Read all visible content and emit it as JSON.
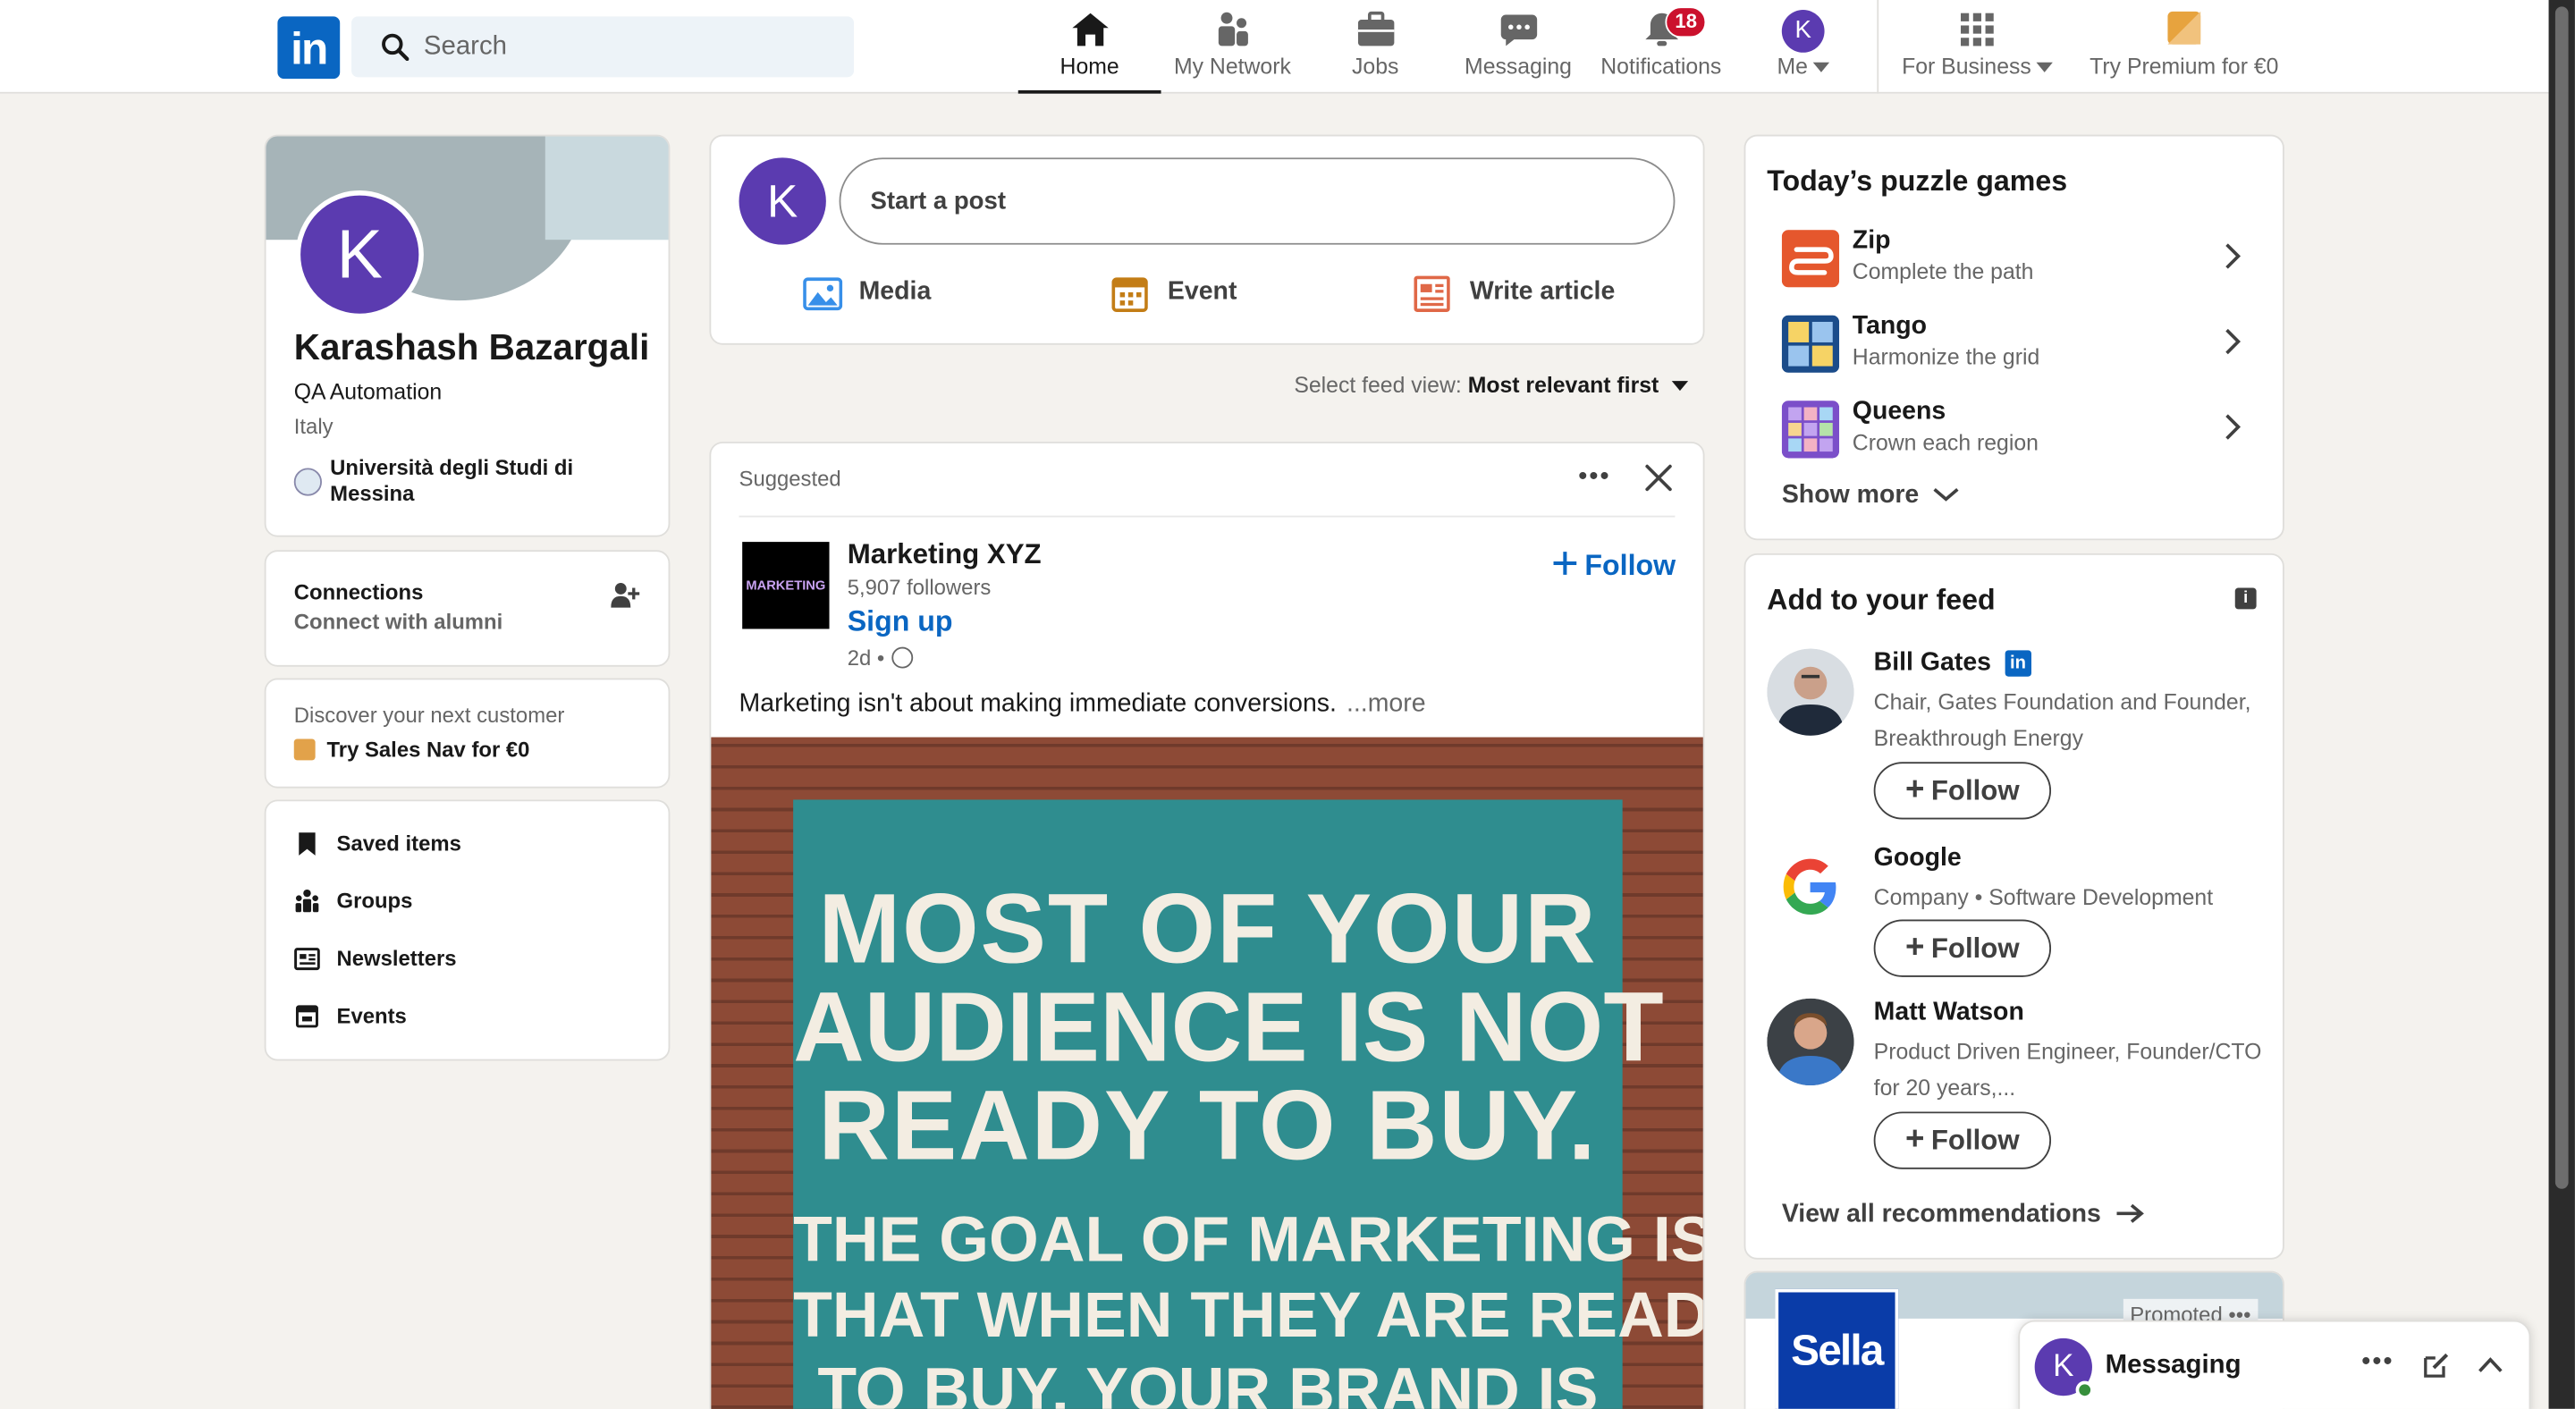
{
  "nav": {
    "logo_text": "in",
    "search_placeholder": "Search",
    "items": [
      {
        "label": "Home",
        "icon": "home-icon"
      },
      {
        "label": "My Network",
        "icon": "people-icon"
      },
      {
        "label": "Jobs",
        "icon": "briefcase-icon"
      },
      {
        "label": "Messaging",
        "icon": "chat-icon"
      },
      {
        "label": "Notifications",
        "icon": "bell-icon"
      },
      {
        "label": "Me",
        "icon": "avatar"
      },
      {
        "label": "For Business",
        "icon": "grid-icon"
      },
      {
        "label": "Try Premium for €0",
        "icon": "premium-icon"
      }
    ],
    "notifications_count": "18",
    "me_initial": "K"
  },
  "profile": {
    "initial": "K",
    "name": "Karashash Bazargali",
    "headline": "QA Automation",
    "location": "Italy",
    "university": "Università degli Studi di Messina"
  },
  "connections": {
    "title": "Connections",
    "subtitle": "Connect with alumni"
  },
  "discover": {
    "title": "Discover your next customer",
    "link": "Try Sales Nav for €0"
  },
  "shortcuts": [
    {
      "label": "Saved items"
    },
    {
      "label": "Groups"
    },
    {
      "label": "Newsletters"
    },
    {
      "label": "Events"
    }
  ],
  "composer": {
    "initial": "K",
    "placeholder": "Start a post",
    "actions": [
      {
        "label": "Media"
      },
      {
        "label": "Event"
      },
      {
        "label": "Write article"
      }
    ]
  },
  "feed_view": {
    "label": "Select feed view:",
    "value": "Most relevant first"
  },
  "post": {
    "tag": "Suggested",
    "author": "Marketing XYZ",
    "logo_text": "MARKETING",
    "followers": "5,907 followers",
    "cta": "Sign up",
    "time": "2d •",
    "follow_label": "Follow",
    "text": "Marketing isn't about making immediate conversions.",
    "more_label": "...more",
    "image_lines": [
      "MOST OF YOUR",
      "AUDIENCE IS NOT",
      "READY TO BUY.",
      "THE GOAL OF MARKETING IS",
      "THAT WHEN THEY ARE READY",
      "TO BUY, YOUR BRAND IS"
    ]
  },
  "puzzles": {
    "title": "Today’s puzzle games",
    "games": [
      {
        "name": "Zip",
        "subtitle": "Complete the path"
      },
      {
        "name": "Tango",
        "subtitle": "Harmonize the grid"
      },
      {
        "name": "Queens",
        "subtitle": "Crown each region"
      }
    ],
    "show_more": "Show more"
  },
  "add_feed": {
    "title": "Add to your feed",
    "info": "i",
    "follow_label": "Follow",
    "recommendations": [
      {
        "name": "Bill Gates",
        "description": "Chair, Gates Foundation and Founder, Breakthrough Energy"
      },
      {
        "name": "Google",
        "description": "Company • Software Development"
      },
      {
        "name": "Matt Watson",
        "description": "Product Driven Engineer, Founder/CTO for 20 years,..."
      }
    ],
    "view_all": "View all recommendations"
  },
  "promo": {
    "brand": "Sella",
    "label": "Promoted"
  },
  "messaging": {
    "initial": "K",
    "title": "Messaging"
  },
  "colors": {
    "brand": "#0a66c2",
    "badge": "#cb112d",
    "avatar": "#5b3bb0",
    "background": "#f4f2ee"
  }
}
